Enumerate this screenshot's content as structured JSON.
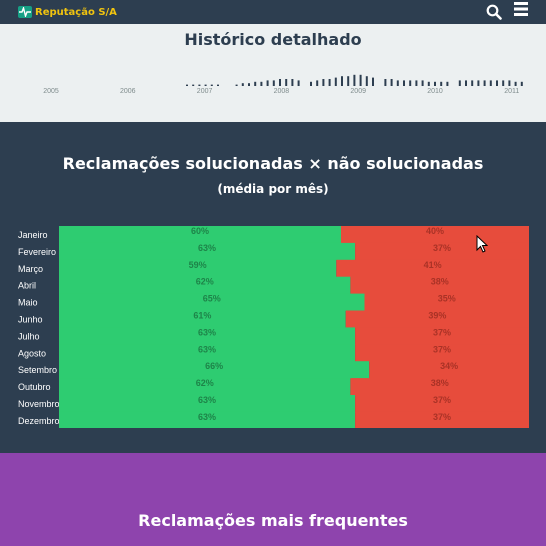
{
  "navbar": {
    "brand": "Reputação S/A",
    "logo_icon": "pulse-icon",
    "search_icon": "search-icon",
    "menu_icon": "hamburger-menu-icon"
  },
  "history": {
    "title": "Histórico detalhado",
    "years": [
      "2005",
      "2006",
      "2007",
      "2008",
      "2009",
      "2010",
      "2011"
    ]
  },
  "solved_section": {
    "title": "Reclamações solucionadas × não solucionadas",
    "subtitle": "(média por mês)"
  },
  "frequent_section": {
    "title": "Reclamações mais frequentes"
  },
  "colors": {
    "solved": "#2ecc71",
    "unsolved": "#e74c3c",
    "header_bg": "#2d3e50",
    "history_bg": "#ecf0f1",
    "frequent_bg": "#8e44ad",
    "brand": "#f1c40f"
  },
  "chart_data": {
    "type": "bar",
    "stacked": true,
    "orientation": "horizontal",
    "categories": [
      "Janeiro",
      "Fevereiro",
      "Março",
      "Abril",
      "Maio",
      "Junho",
      "Julho",
      "Agosto",
      "Setembro",
      "Outubro",
      "Novembro",
      "Dezembro"
    ],
    "series": [
      {
        "values": [
          60,
          63,
          59,
          62,
          65,
          61,
          63,
          63,
          66,
          62,
          63,
          63
        ],
        "labels": [
          "60%",
          "63%",
          "59%",
          "62%",
          "65%",
          "61%",
          "63%",
          "63%",
          "66%",
          "62%",
          "63%",
          "63%"
        ]
      },
      {
        "values": [
          40,
          37,
          41,
          38,
          35,
          39,
          37,
          37,
          34,
          38,
          37,
          37
        ],
        "labels": [
          "40%",
          "37%",
          "41%",
          "38%",
          "35%",
          "39%",
          "37%",
          "37%",
          "34%",
          "38%",
          "37%",
          "37%"
        ]
      }
    ],
    "xlim": [
      0,
      100
    ]
  }
}
